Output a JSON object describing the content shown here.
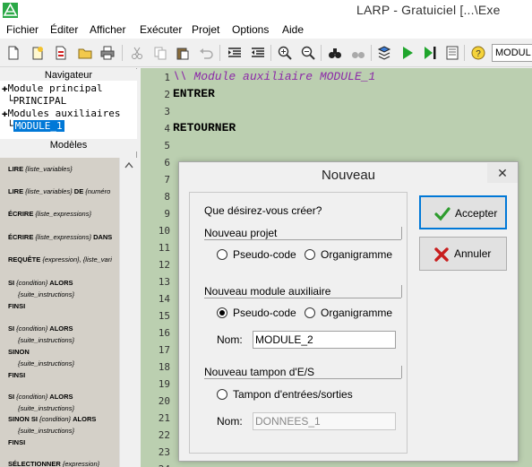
{
  "window": {
    "title": "LARP - Gratuiciel [...\\Exe"
  },
  "menu": [
    "Fichier",
    "Éditer",
    "Afficher",
    "Exécuter",
    "Projet",
    "Options",
    "Aide"
  ],
  "toolbar": {
    "module_combo": "MODUL"
  },
  "navigator": {
    "header": "Navigateur",
    "main_module": "Module principal",
    "main_child": "PRINCIPAL",
    "aux_modules": "Modules auxiliaires",
    "aux_child": "MODULE_1"
  },
  "templates": {
    "header": "Modèles",
    "items": [
      {
        "kw": "LIRE",
        "rest": " {liste_variables}"
      },
      {
        "kw": "LIRE",
        "rest": " {liste_variables} ",
        "kw2": "DE",
        "rest2": " {numéro"
      },
      {
        "kw": "ÉCRIRE",
        "rest": " {liste_expressions}"
      },
      {
        "kw": "ÉCRIRE",
        "rest": " {liste_expressions} ",
        "kw2": "DANS"
      },
      {
        "kw": "REQUÊTE",
        "rest": " {expression}, {liste_vari"
      },
      {
        "kw": "SI",
        "rest": " {condition} ",
        "kw2": "ALORS"
      },
      {
        "indent": "{suite_instructions}"
      },
      {
        "kw": "FINSI"
      },
      {
        "kw": "SI",
        "rest": " {condition} ",
        "kw2": "ALORS"
      },
      {
        "indent": "{suite_instructions}"
      },
      {
        "kw": "SINON"
      },
      {
        "indent": "{suite_instructions}"
      },
      {
        "kw": "FINSI"
      },
      {
        "kw": "SI",
        "rest": " {condition} ",
        "kw2": "ALORS"
      },
      {
        "indent": "{suite_instructions}"
      },
      {
        "kw": "SINON SI",
        "rest": " {condition} ",
        "kw2": "ALORS"
      },
      {
        "indent": "{suite_instructions}"
      },
      {
        "kw": "FINSI"
      },
      {
        "kw": "SÉLECTIONNER",
        "rest": " {expression}"
      }
    ]
  },
  "editor": {
    "line_numbers": [
      "1",
      "2",
      "3",
      "4",
      "5",
      "6",
      "7",
      "8",
      "9",
      "10",
      "11",
      "12",
      "13",
      "14",
      "15",
      "16",
      "17",
      "18",
      "19",
      "20",
      "21",
      "22",
      "23",
      "24"
    ],
    "lines": [
      {
        "text": "\\\\ Module auxiliaire MODULE_1",
        "kind": "comment"
      },
      {
        "text": "ENTRER",
        "kind": "keyword"
      },
      {
        "text": "",
        "kind": "blank"
      },
      {
        "text": "RETOURNER",
        "kind": "keyword"
      }
    ]
  },
  "dialog": {
    "title": "Nouveau",
    "close": "✕",
    "question": "Que désirez-vous créer?",
    "group1": {
      "title": "Nouveau projet",
      "option1": "Pseudo-code",
      "option2": "Organigramme"
    },
    "group2": {
      "title": "Nouveau module auxiliaire",
      "option1": "Pseudo-code",
      "option2": "Organigramme",
      "name_label": "Nom:",
      "name_value": "MODULE_2"
    },
    "group3": {
      "title": "Nouveau tampon d'E/S",
      "option1": "Tampon d'entrées/sorties",
      "name_label": "Nom:",
      "name_value": "DONNEES_1"
    },
    "accept": "Accepter",
    "cancel": "Annuler"
  },
  "colors": {
    "editor_bg": "#bbcfb0",
    "comment": "#8c2aa8",
    "selection": "#0078d7",
    "accept_icon": "#2e9c2e",
    "cancel_icon": "#c81e1e"
  }
}
